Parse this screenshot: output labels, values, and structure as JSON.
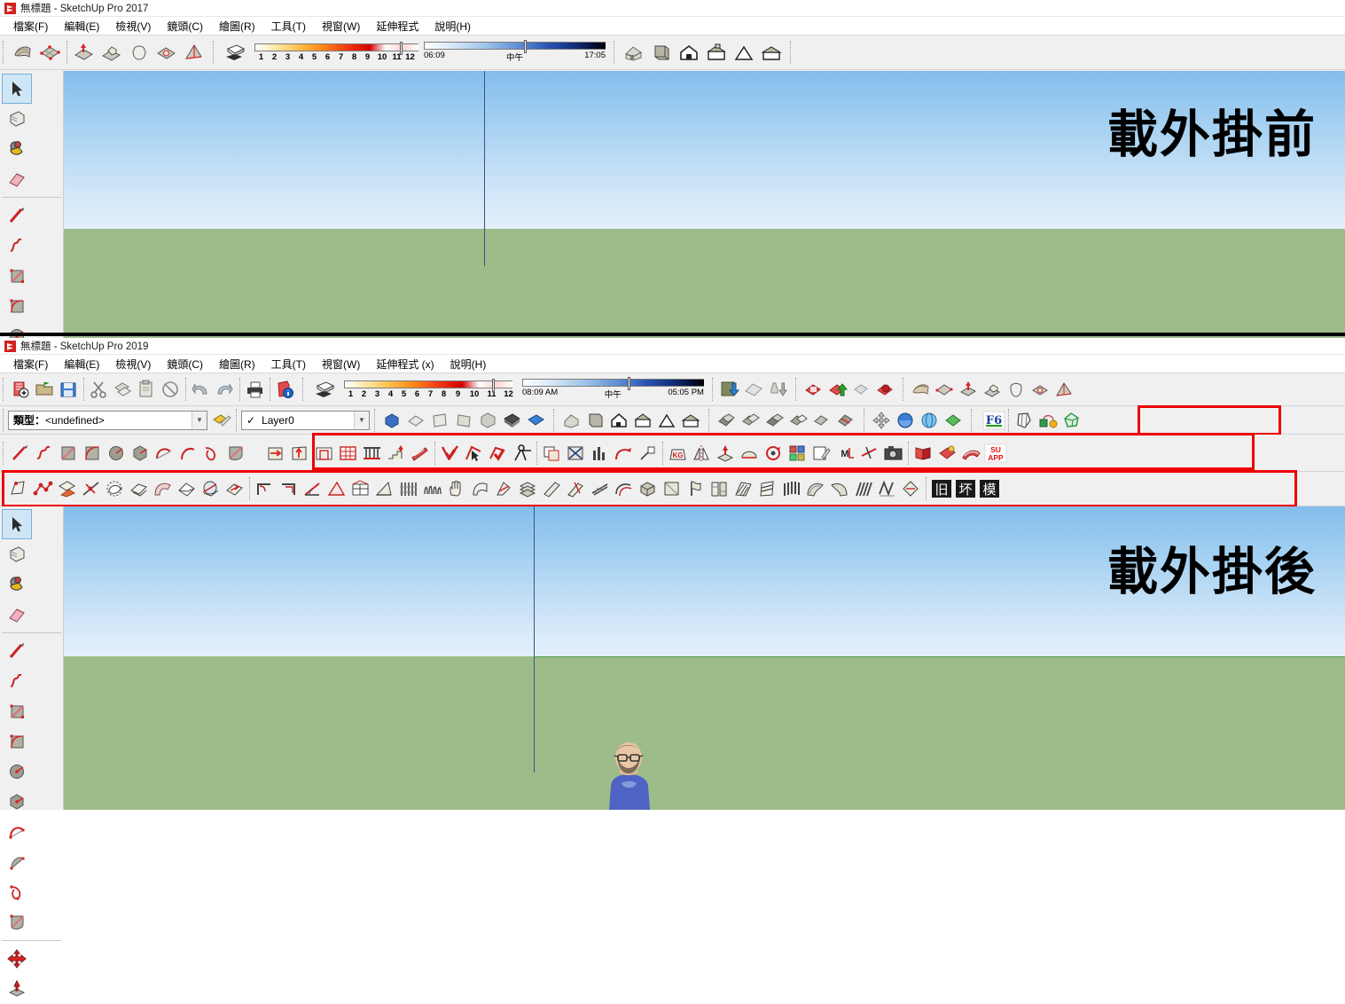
{
  "window_top": {
    "title": "無標題 - SketchUp Pro 2017",
    "menu": [
      {
        "label": "檔案(F)"
      },
      {
        "label": "編輯(E)"
      },
      {
        "label": "檢視(V)"
      },
      {
        "label": "鏡頭(C)"
      },
      {
        "label": "繪圖(R)"
      },
      {
        "label": "工具(T)"
      },
      {
        "label": "視窗(W)"
      },
      {
        "label": "延伸程式"
      },
      {
        "label": "說明(H)"
      }
    ],
    "shadow": {
      "month_ticks": [
        "1",
        "2",
        "3",
        "4",
        "5",
        "6",
        "7",
        "8",
        "9",
        "10",
        "11",
        "12"
      ],
      "sunrise": "06:09",
      "noon": "中午",
      "sunset": "17:05"
    },
    "overlay_text": "載外掛前"
  },
  "window_bottom": {
    "title": "無標題 - SketchUp Pro 2019",
    "menu": [
      {
        "label": "檔案(F)"
      },
      {
        "label": "編輯(E)"
      },
      {
        "label": "檢視(V)"
      },
      {
        "label": "鏡頭(C)"
      },
      {
        "label": "繪圖(R)"
      },
      {
        "label": "工具(T)"
      },
      {
        "label": "視窗(W)"
      },
      {
        "label": "延伸程式 (x)"
      },
      {
        "label": "說明(H)"
      }
    ],
    "shadow": {
      "month_ticks": [
        "1",
        "2",
        "3",
        "4",
        "5",
        "6",
        "7",
        "8",
        "9",
        "10",
        "11",
        "12"
      ],
      "sunrise": "08:09 AM",
      "noon": "中午",
      "sunset": "05:05 PM"
    },
    "type_combo": {
      "label": "類型：",
      "value": "<undefined>"
    },
    "layer_combo": {
      "value": "Layer0",
      "check": "✓"
    },
    "overlay_text": "載外掛後",
    "plugin_text_icons": [
      "旧",
      "坏",
      "模"
    ],
    "su_app_icon": {
      "line1": "SU",
      "line2": "APP"
    },
    "f6_icon": "F6"
  },
  "colors": {
    "sky_top": "#83bdec",
    "sky_bottom": "#e3f0fb",
    "ground": "#9dbc89",
    "axis_blue": "#3c4f8c",
    "axis_green": "#4f9e4f",
    "highlight_red": "#ee0000",
    "toolbar_bg": "#f0f0f0",
    "accent_tool_red": "#cc2222"
  },
  "icons": {
    "top_sandbox": [
      "from-contours-icon",
      "from-scratch-icon",
      "smoove-icon",
      "stamp-icon",
      "drape-icon",
      "add-detail-icon",
      "flip-edge-icon"
    ],
    "top_styles": [
      "xray-house-icon",
      "back-edges-icon",
      "wireframe-house-icon",
      "hidden-line-house-icon",
      "shaded-house-icon",
      "shaded-texture-house-icon"
    ],
    "left_palette": [
      "select-arrow-icon",
      "make-component-icon",
      "paint-bucket-icon",
      "eraser-icon",
      "line-icon",
      "freehand-icon",
      "rectangle-icon",
      "rotated-rectangle-icon",
      "circle-icon",
      "polygon-icon",
      "arc-icon",
      "two-point-arc-icon",
      "three-point-arc-icon",
      "pie-icon",
      "move-icon",
      "push-pull-icon"
    ],
    "standard_toolbar": [
      "new-icon",
      "open-icon",
      "save-icon",
      "cut-icon",
      "copy-icon",
      "paste-icon",
      "erase-icon",
      "undo-icon",
      "redo-icon",
      "print-icon",
      "model-info-icon"
    ]
  }
}
